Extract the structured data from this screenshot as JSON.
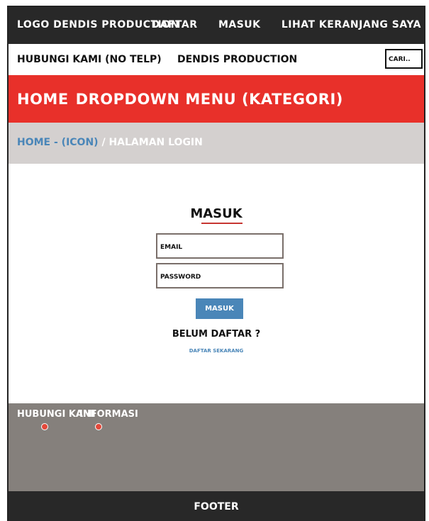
{
  "header": {
    "logo": "LOGO DENDIS PRODUCTION",
    "nav": [
      "DAFTAR",
      "MASUK",
      "LIHAT KERANJANG SAYA"
    ]
  },
  "infobar": {
    "contact": "HUBUNGI KAMI (NO TELP)",
    "brand": "DENDIS PRODUCTION",
    "search_placeholder": "CARI.."
  },
  "menubar": {
    "home": "HOME",
    "dropdown": "DROPDOWN MENU (KATEGORI)"
  },
  "breadcrumb": {
    "home": "HOME - (ICON)",
    "separator": " / ",
    "current": "HALAMAN LOGIN"
  },
  "login": {
    "title": "MASUK",
    "email_placeholder": "EMAIL",
    "password_placeholder": "PASSWORD",
    "submit": "MASUK",
    "not_registered": "BELUM DAFTAR ?",
    "register_link": "DAFTAR SEKARANG"
  },
  "footer_area": {
    "contact_heading": "HUBUNGI KAMI",
    "info_heading": "INFORMASI"
  },
  "footer": {
    "label": "FOOTER"
  },
  "colors": {
    "topbar": "#282828",
    "menubar": "#e8302a",
    "crumbbar": "#d4d0cf",
    "accent_blue": "#4a86b8",
    "footer_area": "#85807c"
  }
}
